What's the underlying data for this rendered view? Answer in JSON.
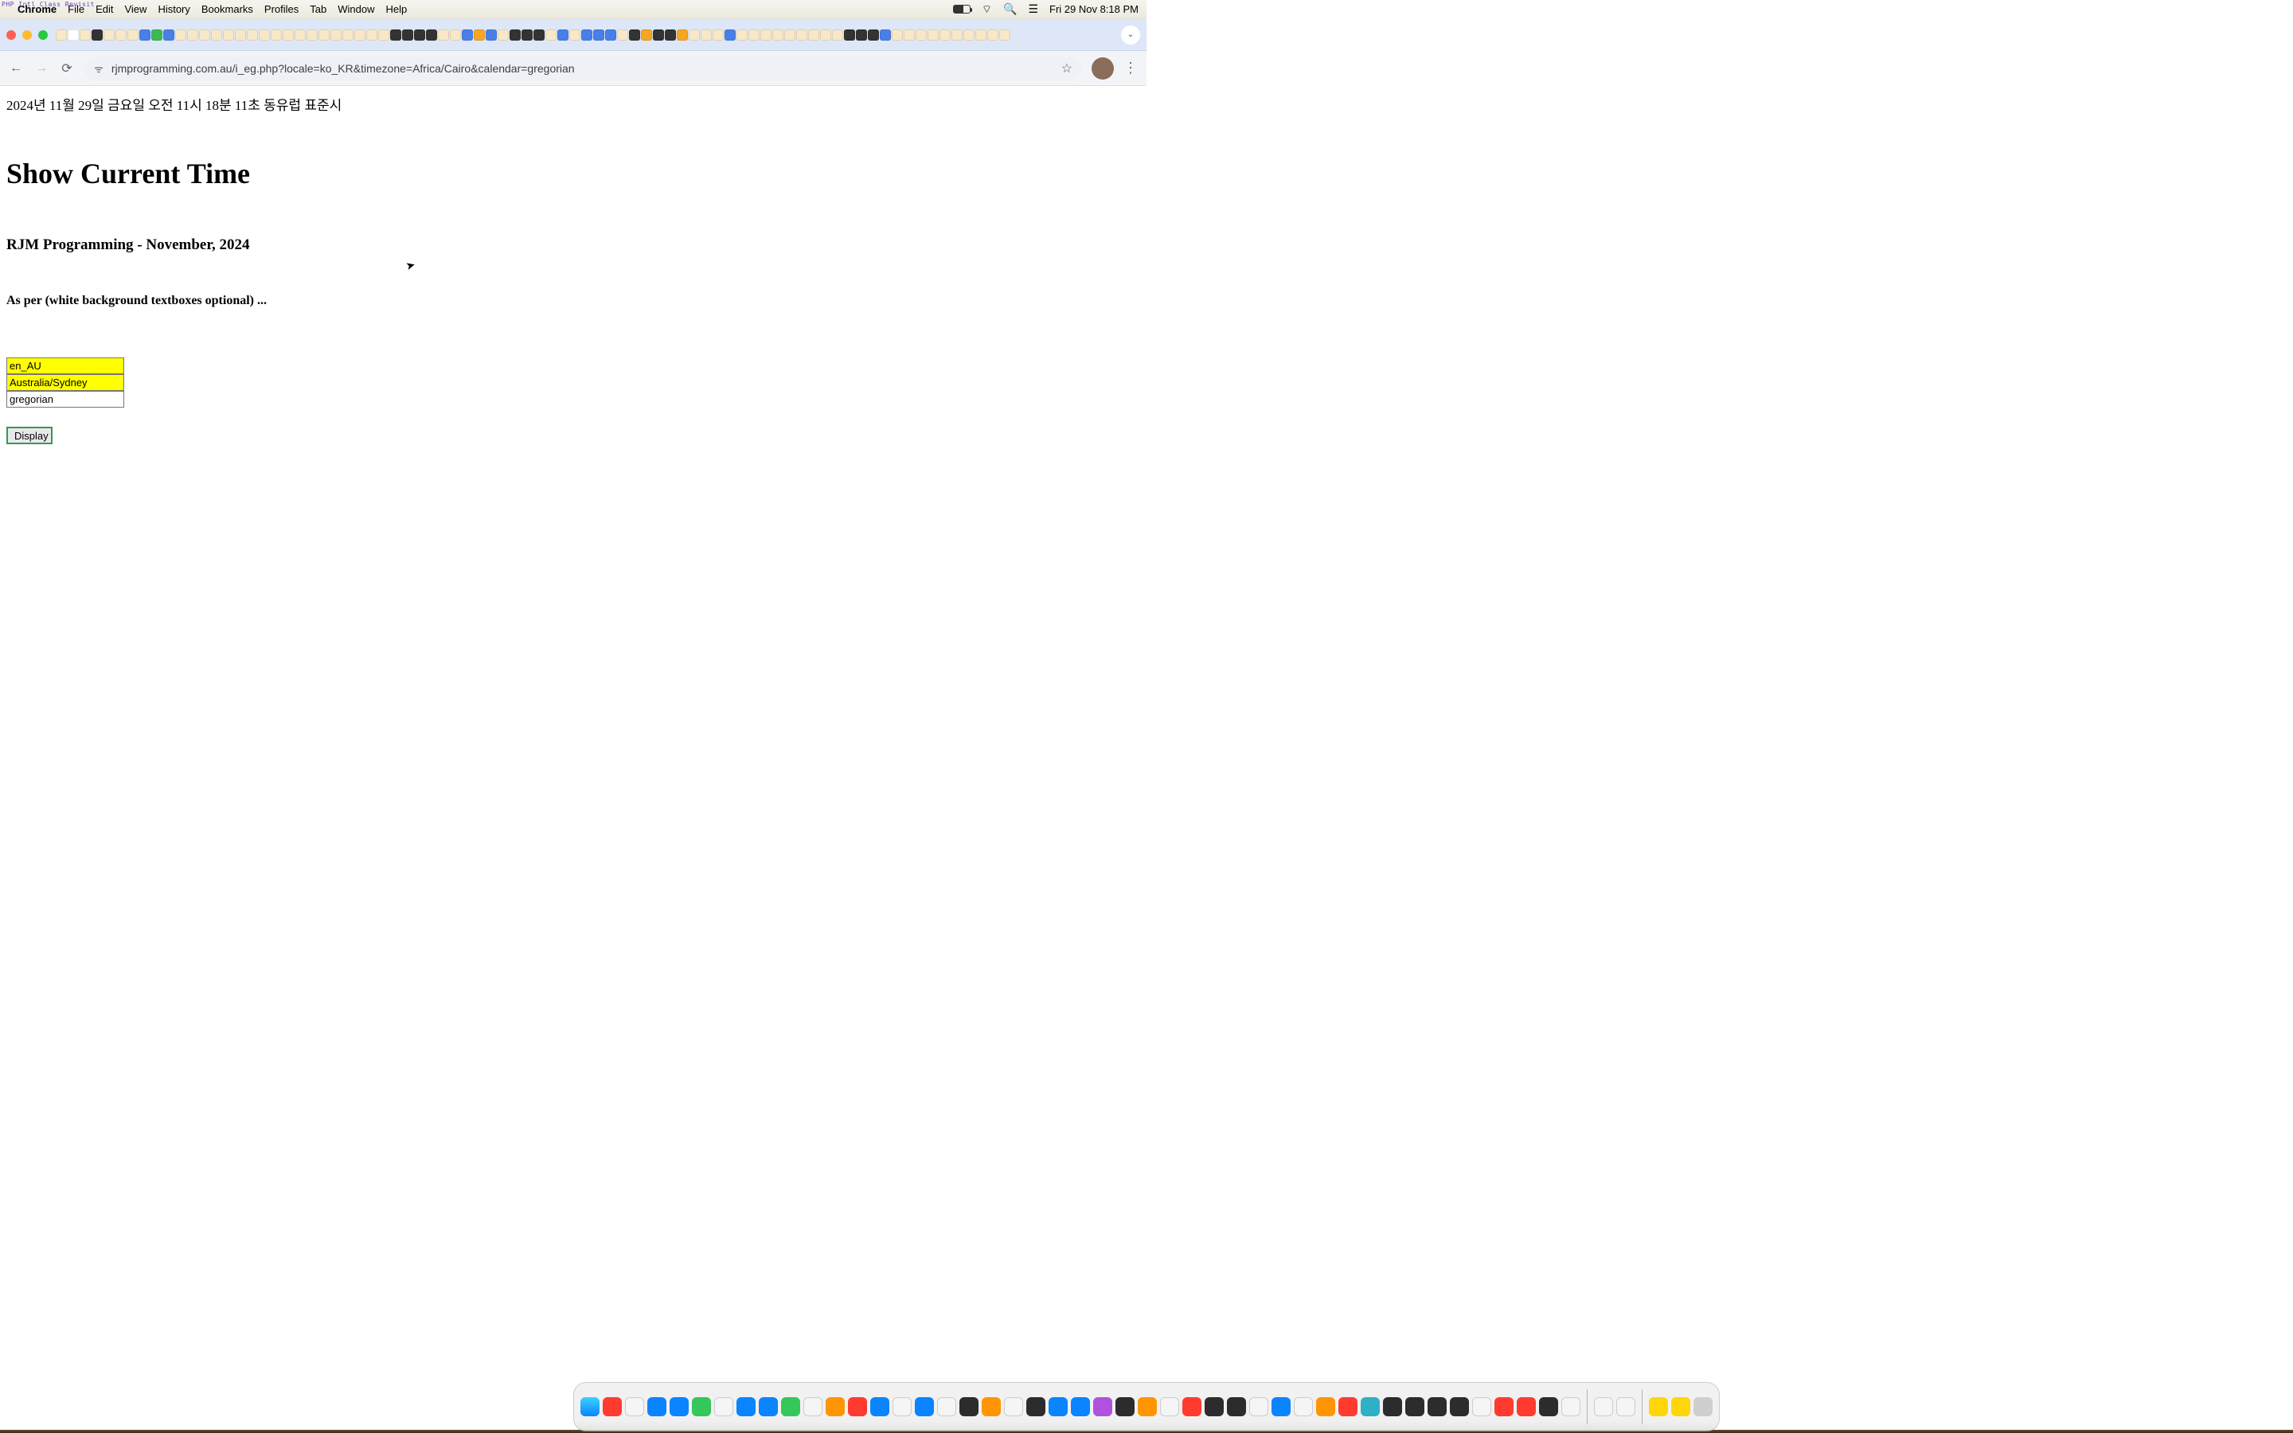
{
  "menubar": {
    "apple": "",
    "appname": "Chrome",
    "items": [
      "File",
      "Edit",
      "View",
      "History",
      "Bookmarks",
      "Profiles",
      "Tab",
      "Window",
      "Help"
    ],
    "overlay": "PHP Intl Class Revisit",
    "clock": "Fri 29 Nov  8:18 PM"
  },
  "browser": {
    "url": "rjmprogramming.com.au/i_eg.php?locale=ko_KR&timezone=Africa/Cairo&calendar=gregorian",
    "newtab": "+",
    "dropdown": "⌄"
  },
  "page": {
    "datetime_line": "2024년 11월 29일 금요일 오전 11시 18분 11초 동유럽 표준시",
    "h1": "Show Current Time",
    "h3": "RJM Programming - November, 2024",
    "h4": "As per (white background textboxes optional) ...",
    "inputs": {
      "locale": "en_AU",
      "timezone": "Australia/Sydney",
      "calendar": "gregorian"
    },
    "button": "Display"
  }
}
